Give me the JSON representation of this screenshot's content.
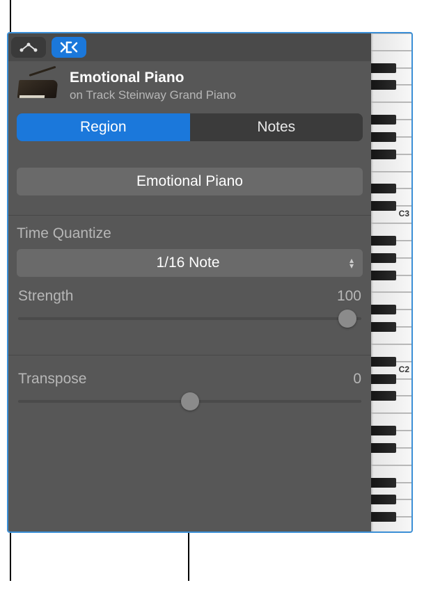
{
  "header": {
    "title": "Emotional Piano",
    "subtitle": "on Track Steinway Grand Piano"
  },
  "tabs": {
    "region": "Region",
    "notes": "Notes"
  },
  "region_name": "Emotional Piano",
  "time_quantize": {
    "label": "Time Quantize",
    "value": "1/16 Note",
    "strength_label": "Strength",
    "strength_value": "100"
  },
  "transpose": {
    "label": "Transpose",
    "value": "0"
  },
  "keyboard": {
    "labels": {
      "c3": "C3",
      "c2": "C2"
    }
  }
}
